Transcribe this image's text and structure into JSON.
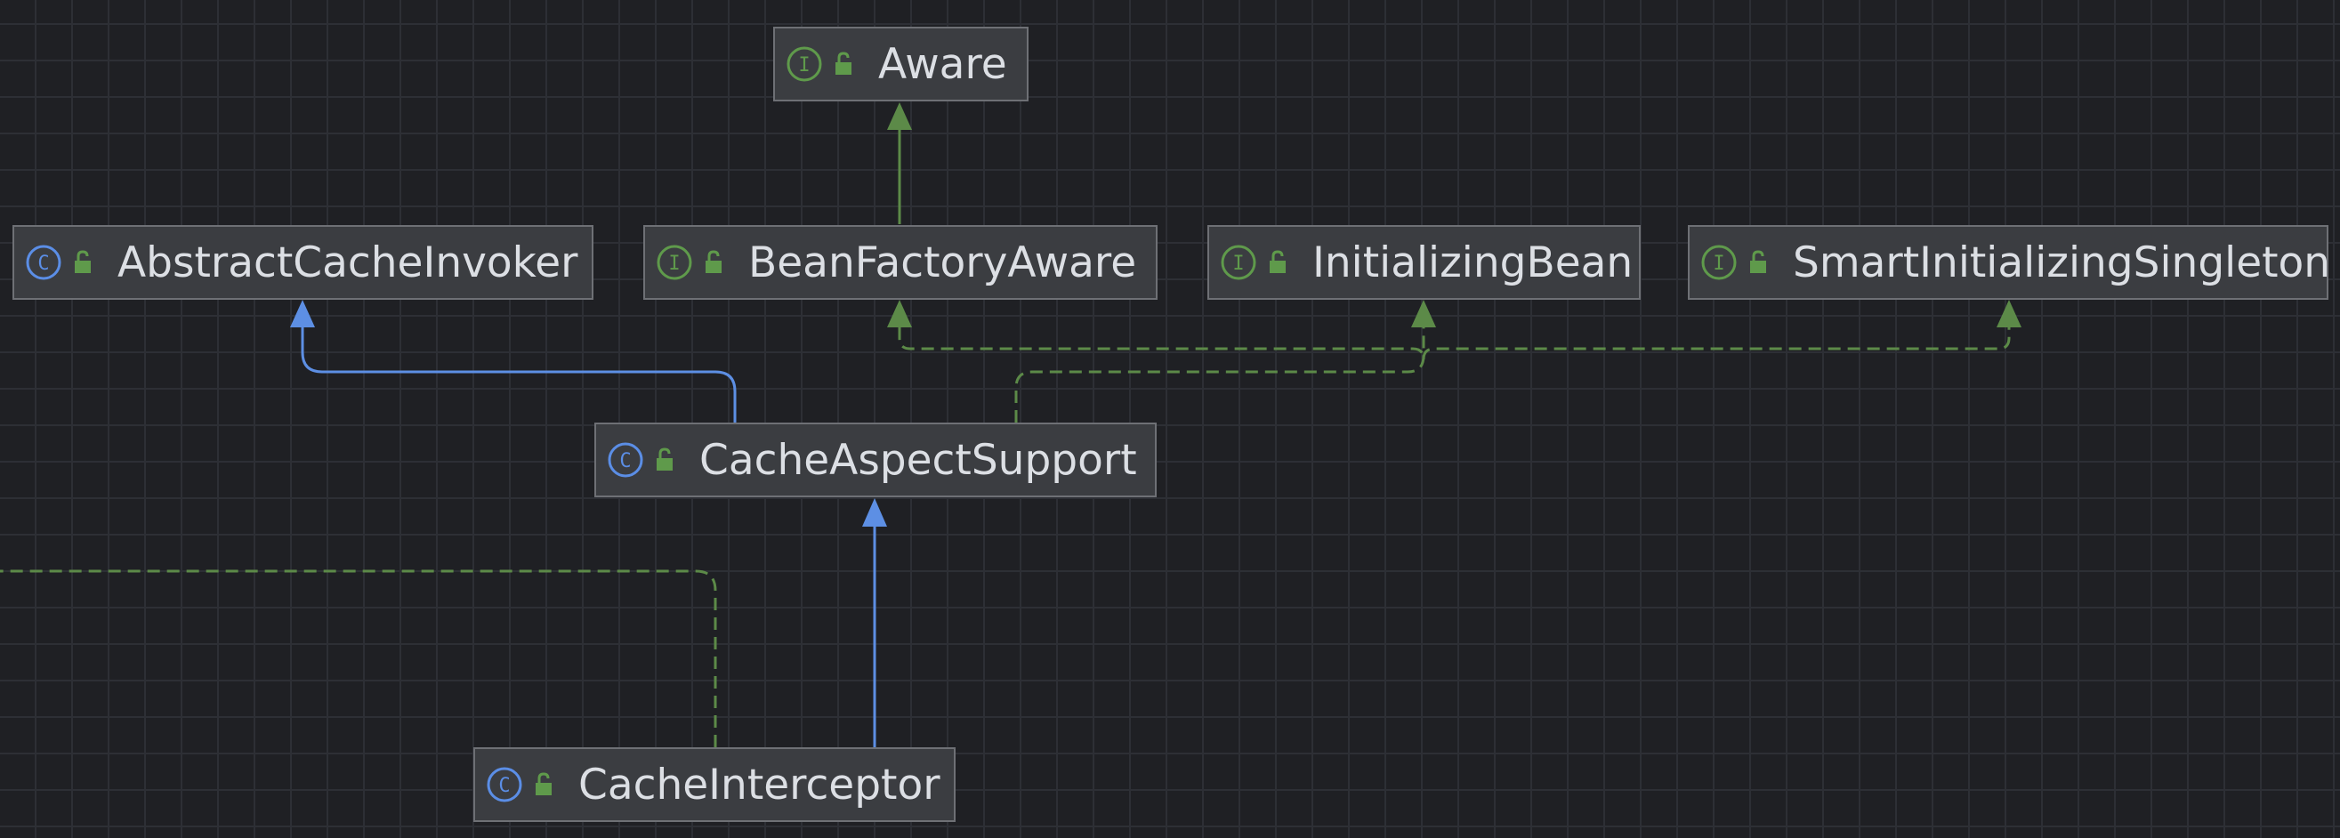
{
  "diagram": {
    "nodes": [
      {
        "id": "aware",
        "kind": "interface",
        "icon": "interface-icon",
        "label": "Aware"
      },
      {
        "id": "abstract-cache-invoker",
        "kind": "class",
        "icon": "class-icon",
        "label": "AbstractCacheInvoker"
      },
      {
        "id": "bean-factory-aware",
        "kind": "interface",
        "icon": "interface-icon",
        "label": "BeanFactoryAware"
      },
      {
        "id": "initializing-bean",
        "kind": "interface",
        "icon": "interface-icon",
        "label": "InitializingBean"
      },
      {
        "id": "smart-initializing-singleton",
        "kind": "interface",
        "icon": "interface-icon",
        "label": "SmartInitializingSingleton"
      },
      {
        "id": "cache-aspect-support",
        "kind": "class",
        "icon": "class-icon",
        "label": "CacheAspectSupport"
      },
      {
        "id": "cache-interceptor",
        "kind": "class",
        "icon": "class-icon",
        "label": "CacheInterceptor"
      }
    ],
    "edges": [
      {
        "from": "bean-factory-aware",
        "to": "aware",
        "type": "extends-interface",
        "style": "solid"
      },
      {
        "from": "cache-aspect-support",
        "to": "abstract-cache-invoker",
        "type": "extends",
        "style": "solid"
      },
      {
        "from": "cache-aspect-support",
        "to": "bean-factory-aware",
        "type": "implements",
        "style": "dashed"
      },
      {
        "from": "cache-aspect-support",
        "to": "initializing-bean",
        "type": "implements",
        "style": "dashed"
      },
      {
        "from": "cache-aspect-support",
        "to": "smart-initializing-singleton",
        "type": "implements",
        "style": "dashed"
      },
      {
        "from": "cache-interceptor",
        "to": "cache-aspect-support",
        "type": "extends",
        "style": "solid"
      },
      {
        "from": "cache-interceptor",
        "to": "offscreen",
        "type": "implements",
        "style": "dashed"
      }
    ],
    "colors": {
      "background": "#1f2024",
      "grid": "#2d2f35",
      "node_fill": "#3b3d41",
      "node_border": "#6e7075",
      "text": "#dcdfe4",
      "class_icon": "#5b8ee6",
      "interface_icon": "#5f9a4b",
      "extends_edge": "#5d8fe4",
      "implements_edge": "#5c8a48",
      "lock": "#5f9a4b"
    }
  }
}
